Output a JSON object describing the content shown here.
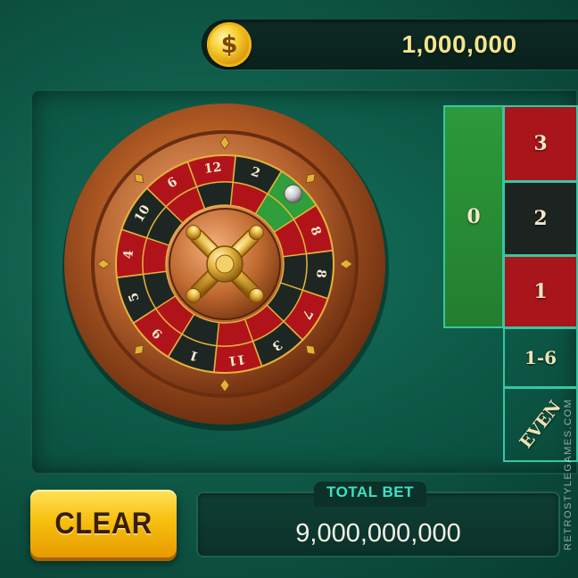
{
  "balance": {
    "icon": "dollar-coin-icon",
    "symbol": "$",
    "amount": "1,000,000"
  },
  "wheel": {
    "outer_numbers": [
      "12",
      "2",
      "0",
      "8",
      "8",
      "7",
      "3",
      "11",
      "1",
      "9",
      "5",
      "4",
      "10",
      "6"
    ],
    "outer_colors": [
      "red",
      "black",
      "green",
      "red",
      "black",
      "red",
      "black",
      "red",
      "black",
      "red",
      "black",
      "red",
      "black",
      "red"
    ],
    "inner_colors": [
      "black",
      "red",
      "green",
      "red",
      "black",
      "black",
      "red",
      "red",
      "black",
      "red",
      "black",
      "red",
      "black",
      "red"
    ],
    "ball_position": "0"
  },
  "table": {
    "zero": "0",
    "numbers": [
      "3",
      "2",
      "1"
    ],
    "low_bet": "1-6",
    "even_bet": "EVEN"
  },
  "controls": {
    "clear_label": "CLEAR"
  },
  "total_bet": {
    "label": "TOTAL BET",
    "value": "9,000,000,000"
  },
  "watermark": "RETROSTYLEGAMES.COM",
  "colors": {
    "felt": "#0d5846",
    "red": "#b0141a",
    "black": "#1e2624",
    "green": "#2f9e3b",
    "gold": "#e3b23a",
    "accent": "#3fe0c4"
  }
}
